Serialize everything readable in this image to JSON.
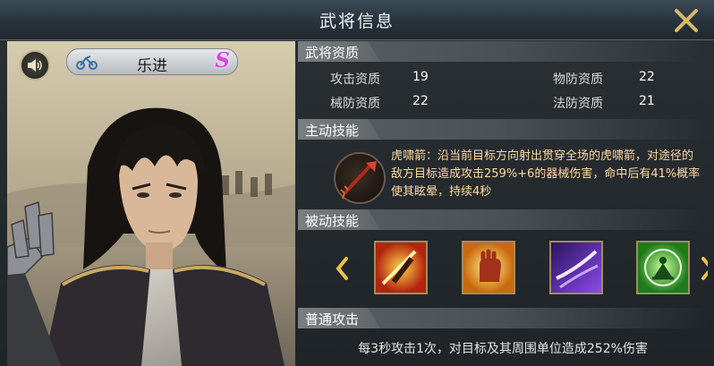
{
  "window": {
    "title": "武将信息"
  },
  "hero": {
    "name": "乐进",
    "rank": "S"
  },
  "sections": {
    "aptitude": "武将资质",
    "active": "主动技能",
    "passive": "被动技能",
    "normal": "普通攻击"
  },
  "stats": [
    {
      "label": "攻击资质",
      "value": "19"
    },
    {
      "label": "物防资质",
      "value": "22"
    },
    {
      "label": "械防资质",
      "value": "22"
    },
    {
      "label": "法防资质",
      "value": "21"
    }
  ],
  "active_skill": {
    "icon": "arrow-icon",
    "line1": "虎啸箭：沿当前目标方向射出贯穿全场的虎啸箭，对途径的",
    "line2": "敌方目标造成攻击259%+6的器械伤害，命中后有41%概率",
    "line3": "使其眩晕，持续4秒"
  },
  "passive_skills": [
    {
      "icon": "sword-slash-icon",
      "color": "#d8551f"
    },
    {
      "icon": "fist-icon",
      "color": "#e8a21a"
    },
    {
      "icon": "purple-slash-icon",
      "color": "#7a3bd8"
    },
    {
      "icon": "meditation-icon",
      "color": "#3fb83a"
    }
  ],
  "normal_attack": {
    "text": "每3秒攻击1次，对目标及其周围单位造成252%伤害"
  },
  "icons": {
    "close": "close-icon",
    "sound": "sound-icon",
    "mount": "mount-icon",
    "left": "chevron-left-icon",
    "right": "chevron-right-icon"
  },
  "colors": {
    "accent": "#ffd9a0",
    "rank": "#e040e8",
    "close": "#d9b86a"
  }
}
